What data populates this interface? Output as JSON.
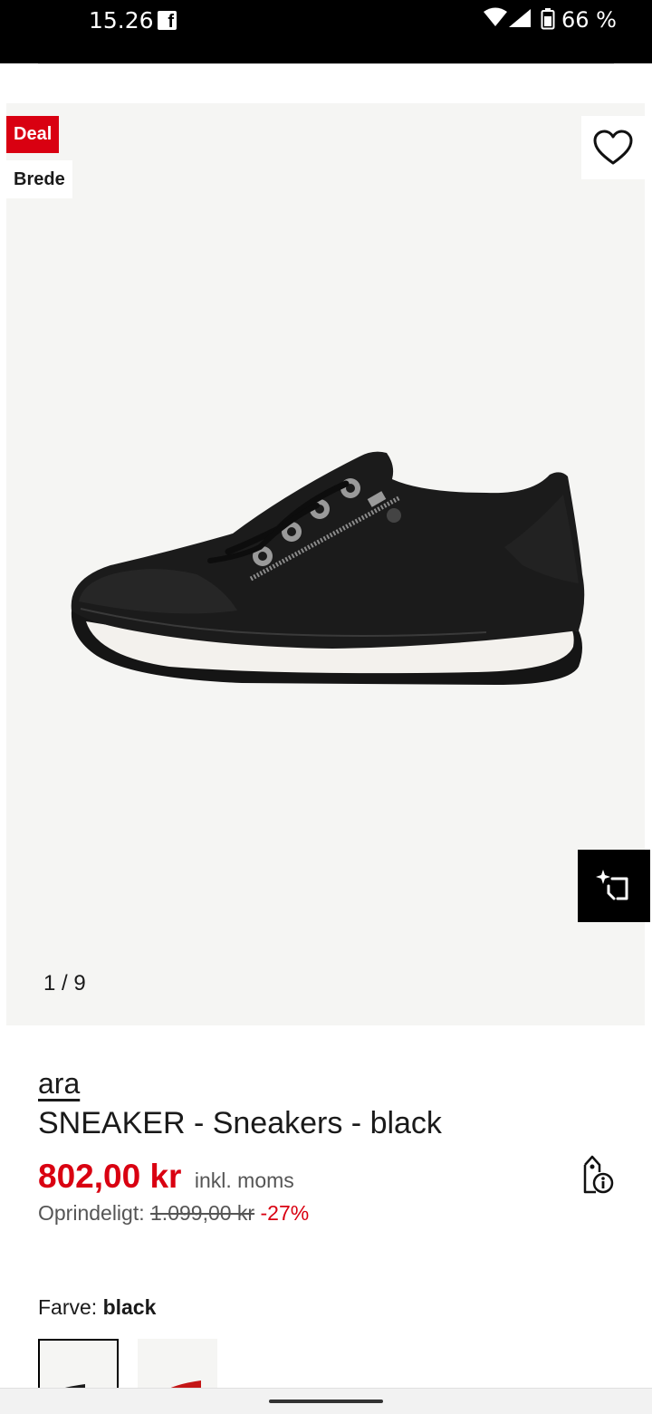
{
  "status_bar": {
    "time": "15.26",
    "battery": "66 %",
    "notification_icon": "facebook-icon"
  },
  "gallery": {
    "badges": {
      "deal": "Deal",
      "fit": "Brede"
    },
    "counter": "1 / 9",
    "icons": [
      "heart-icon",
      "ar-view-icon"
    ]
  },
  "product": {
    "brand": "ara",
    "title": "SNEAKER - Sneakers - black",
    "price": "802,00 kr",
    "vat": "inkl. moms",
    "original_label": "Oprindeligt:",
    "original_price": "1.099,00 kr",
    "discount": "-27%",
    "price_info_icon": "price-tag-info-icon"
  },
  "color": {
    "label": "Farve:",
    "selected": "black"
  },
  "colors": {
    "accent_red": "#d90011",
    "gallery_bg": "#f5f5f3"
  }
}
